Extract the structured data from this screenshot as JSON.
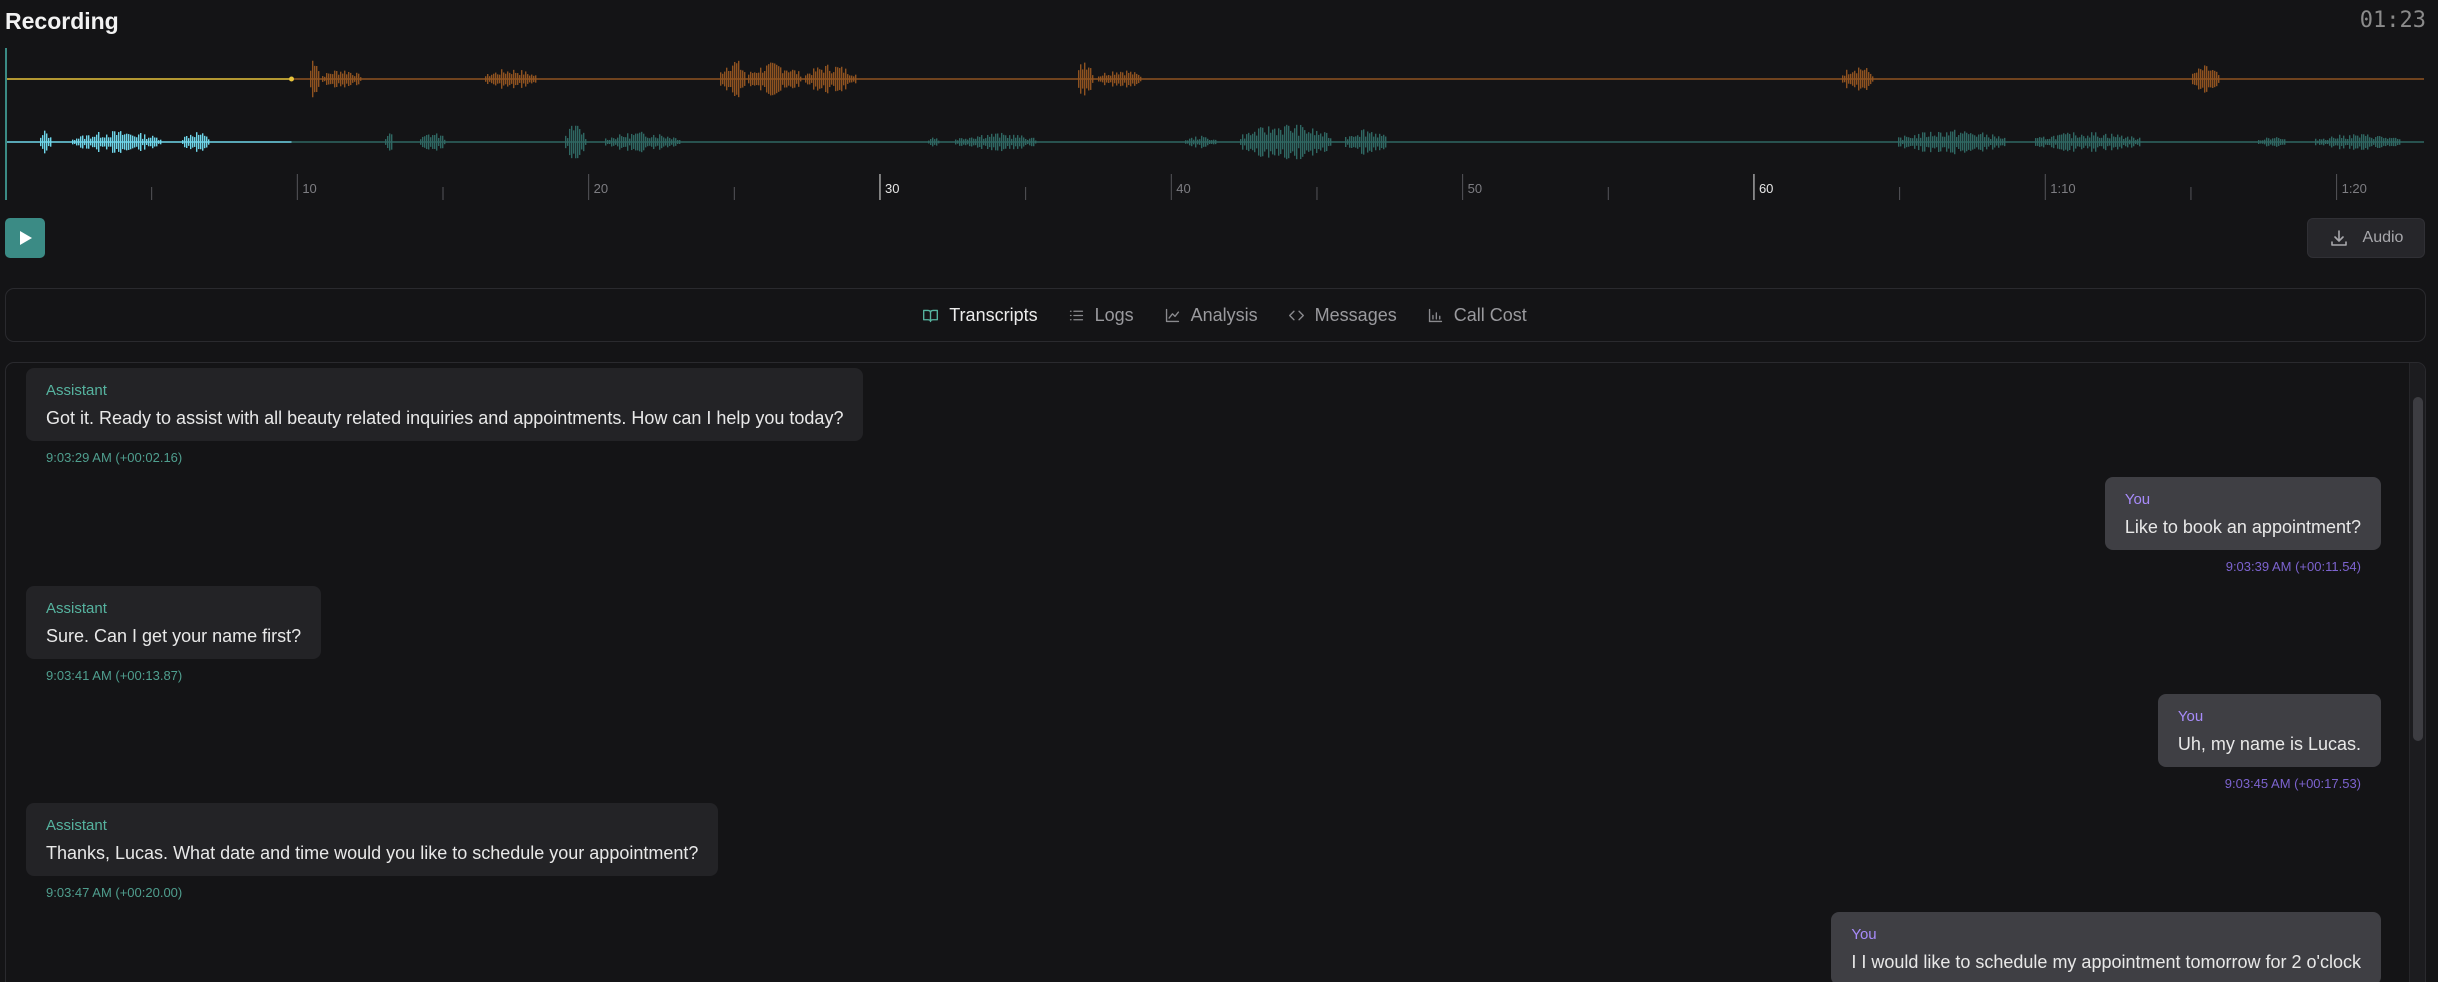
{
  "header": {
    "title": "Recording",
    "duration": "01:23"
  },
  "colors": {
    "played_top": "#e8c33c",
    "unplayed_top": "#8f5320",
    "played_bottom": "#6fd6ea",
    "unplayed_bottom": "#2f6762",
    "accent": "#3b8b85",
    "assistant_label": "#56b39f",
    "user_label": "#a78bfa"
  },
  "timeline": {
    "ticks": [
      "10",
      "20",
      "30",
      "40",
      "50",
      "60",
      "1:10",
      "1:20"
    ],
    "playhead_seconds": 9.8,
    "total_seconds": 83
  },
  "controls": {
    "play_icon": "play-icon",
    "audio_label": "Audio",
    "audio_icon": "download-icon"
  },
  "tabs": [
    {
      "label": "Transcripts",
      "icon": "book-open-icon",
      "active": true
    },
    {
      "label": "Logs",
      "icon": "list-icon",
      "active": false
    },
    {
      "label": "Analysis",
      "icon": "line-chart-icon",
      "active": false
    },
    {
      "label": "Messages",
      "icon": "code-icon",
      "active": false
    },
    {
      "label": "Call Cost",
      "icon": "bar-chart-icon",
      "active": false
    }
  ],
  "messages": [
    {
      "role": "assistant",
      "speaker": "Assistant",
      "text": "Got it. Ready to assist with all beauty related inquiries and appointments. How can I help you today?",
      "time": "9:03:29 AM (+00:02.16)"
    },
    {
      "role": "user",
      "speaker": "You",
      "text": "Like to book an appointment?",
      "time": "9:03:39 AM (+00:11.54)"
    },
    {
      "role": "assistant",
      "speaker": "Assistant",
      "text": "Sure. Can I get your name first?",
      "time": "9:03:41 AM (+00:13.87)"
    },
    {
      "role": "user",
      "speaker": "You",
      "text": "Uh, my name is Lucas.",
      "time": "9:03:45 AM (+00:17.53)"
    },
    {
      "role": "assistant",
      "speaker": "Assistant",
      "text": "Thanks, Lucas. What date and time would you like to schedule your appointment?",
      "time": "9:03:47 AM (+00:20.00)"
    },
    {
      "role": "user",
      "speaker": "You",
      "text": "I I would like to schedule my appointment tomorrow for 2 o'clock",
      "time": ""
    }
  ]
}
